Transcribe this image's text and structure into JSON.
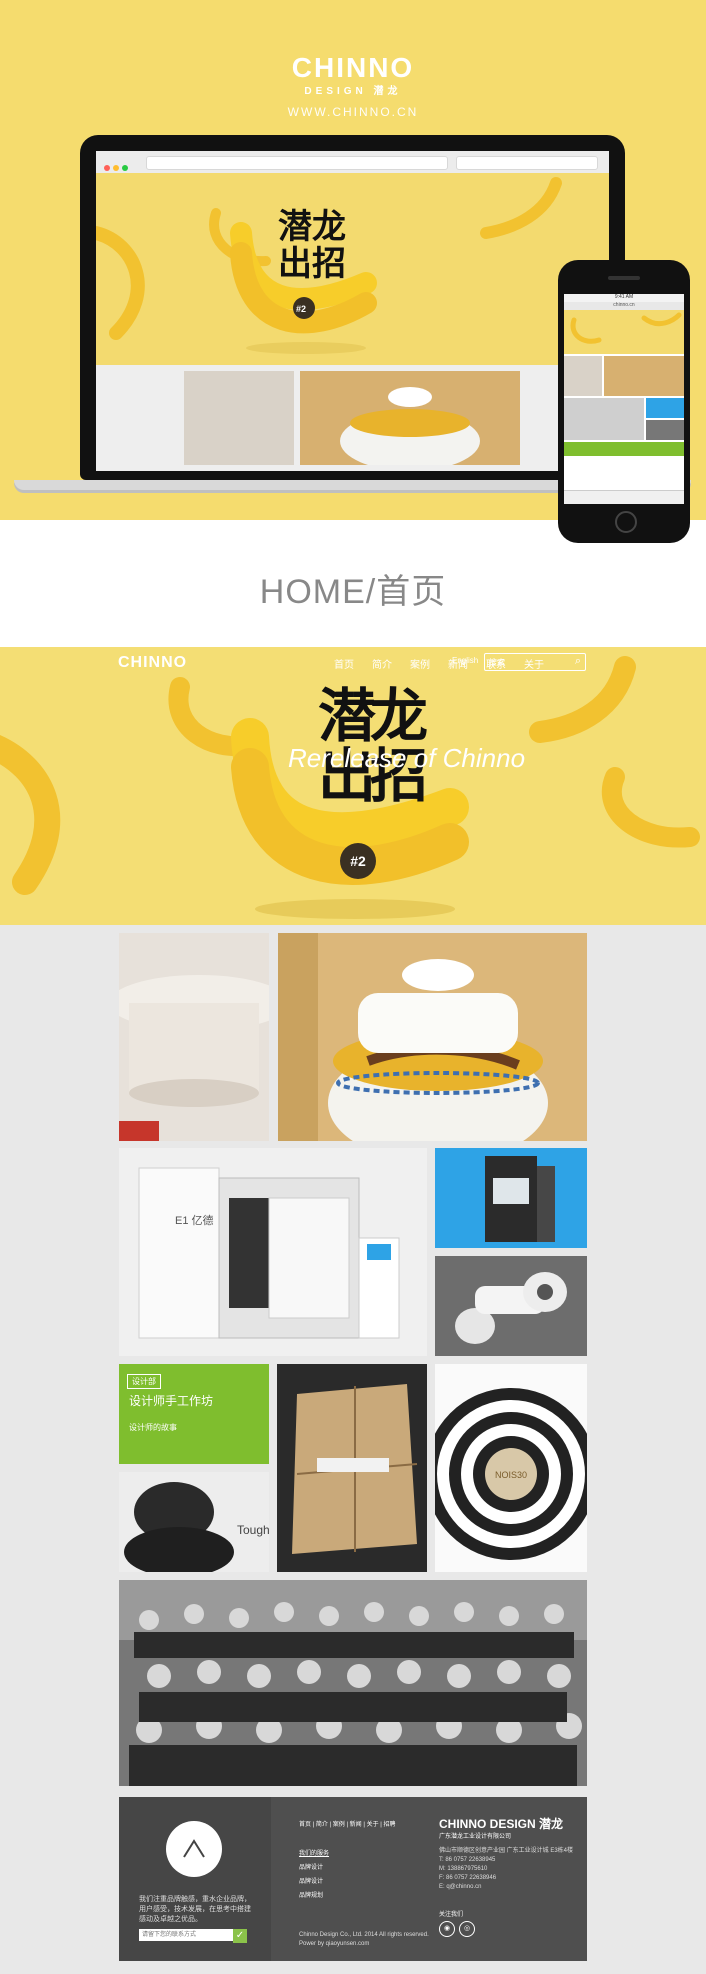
{
  "brand": {
    "logo_text": "CHINNO",
    "logo_sub": "DESIGN 潜龙",
    "url": "WWW.CHINNO.CN"
  },
  "section_title": "HOME/首页",
  "banner": {
    "title_cn": "潜龙出招",
    "title_en": "Rerelease of Chinno",
    "badge": "#2"
  },
  "nav": {
    "items": [
      "首页",
      "简介",
      "案例",
      "新闻",
      "联系",
      "关于"
    ],
    "language": "English",
    "search_placeholder": "搜索"
  },
  "phone": {
    "time": "9:41 AM",
    "url": "chinno.cn"
  },
  "studio_tile": {
    "tag": "设计部",
    "title": "设计师手工作坊",
    "more": "设计师的故事"
  },
  "target_tile": {
    "text": "NOIS30"
  },
  "product_tiles": {
    "machine_label": "E1 亿德",
    "tough_text": "Tough"
  },
  "footer": {
    "desc": "我们注重品牌触感，重水企业品牌，用户感受，技术发展，在思考中搭建感动及卓越之优品。",
    "input_placeholder": "请留下您的联系方式",
    "links": "首页 | 简介 | 案例 | 新闻 | 关于 | 招聘",
    "sub_title": "我们的服务",
    "sub_items": [
      "品牌设计",
      "品牌设计",
      "品牌规划"
    ],
    "copyright": "Chinno Design Co., Ltd. 2014 All rights reserved.",
    "powered": "Power by qiaoyunsen.com",
    "brand": "CHINNO DESIGN 潜龙",
    "company": "广东潜龙工业设计有限公司",
    "address": "佛山市顺德区创意产业园 广东工业设计城 E3栋4楼",
    "tel": "T: 86 0757 22638945",
    "mob": "M: 138867975610",
    "fax": "F: 86 0757 22638946",
    "email": "E: q@chinno.cn",
    "follow": "关注我们"
  },
  "colors": {
    "hero_yellow": "#f5dc6e",
    "studio_green": "#7fbe2e",
    "device_blue": "#2ea3e6",
    "footer_dark": "#4f4f4f"
  }
}
